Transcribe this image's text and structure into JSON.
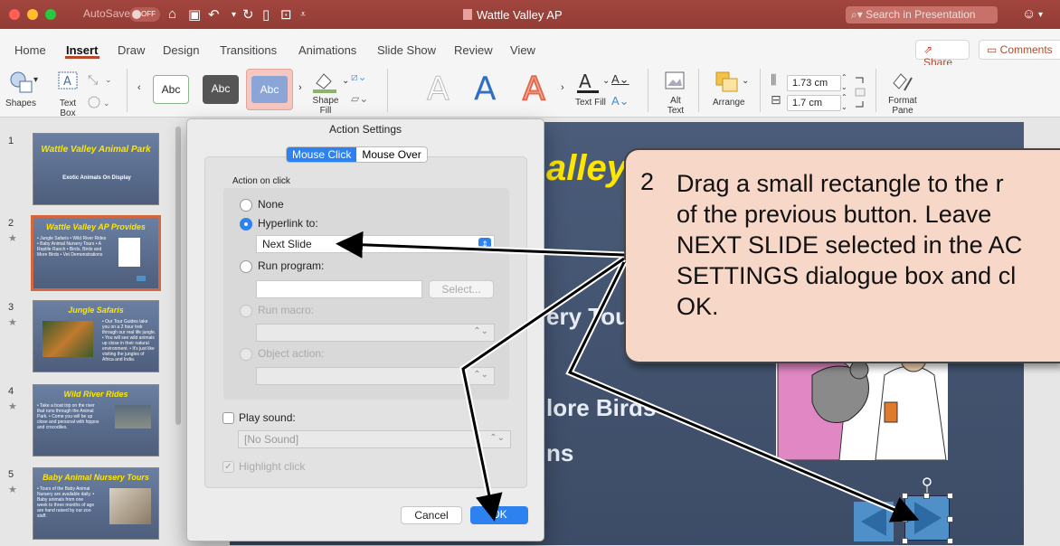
{
  "titlebar": {
    "autosave": "AutoSave",
    "autosave_state": "OFF",
    "title": "Wattle Valley AP",
    "search_placeholder": "Search in Presentation"
  },
  "tabs": [
    "Home",
    "Insert",
    "Draw",
    "Design",
    "Transitions",
    "Animations",
    "Slide Show",
    "Review",
    "View"
  ],
  "share_label": "Share",
  "comments_label": "Comments",
  "ribbon": {
    "shapes": "Shapes",
    "text_box_1": "Text",
    "text_box_2": "Box",
    "style_abc": "Abc",
    "shape_fill_1": "Shape",
    "shape_fill_2": "Fill",
    "text_fill": "Text Fill",
    "alt_text_1": "Alt",
    "alt_text_2": "Text",
    "arrange": "Arrange",
    "height": "1.73 cm",
    "width": "1.7 cm",
    "format_pane_1": "Format",
    "format_pane_2": "Pane"
  },
  "slides": [
    {
      "num": "1",
      "title": "Wattle Valley Animal Park",
      "body": "Exotic Animals On Display"
    },
    {
      "num": "2",
      "title": "Wattle Valley AP Provides",
      "body": "• Jungle Safaris • Wild River Rides • Baby Animal Nursery Tours • A Reptile Ranch • Birds, Birds and More Birds • Vet Demonstrations"
    },
    {
      "num": "3",
      "title": "Jungle Safaris",
      "body": "• Our Tour Guides take you on a 2 hour trek through our real life jungle. • You will see wild animals up close in their natural environment. • It's just like visiting the jungles of Africa and India."
    },
    {
      "num": "4",
      "title": "Wild River Rides",
      "body": "• Take a boat trip on the river that runs through the Animal Park. • Come you will be up close and personal with hippos and crocodiles."
    },
    {
      "num": "5",
      "title": "Baby Animal Nursery Tours",
      "body": "• Tours of the Baby Animal Nursery are available daily. • Baby animals from one week to three months of age are hand raised by our zoo staff."
    }
  ],
  "main_slide": {
    "title_fragment": "alley",
    "bullet_1": "ery Tou",
    "bullet_2": "lore Birds",
    "bullet_3": "ns"
  },
  "dialog": {
    "title": "Action Settings",
    "tab_mouse_click": "Mouse Click",
    "tab_mouse_over": "Mouse Over",
    "action_on_click": "Action on click",
    "none": "None",
    "hyperlink_to": "Hyperlink to:",
    "hyperlink_value": "Next Slide",
    "run_program": "Run program:",
    "select": "Select...",
    "run_macro": "Run macro:",
    "object_action": "Object action:",
    "play_sound": "Play sound:",
    "sound_value": "[No Sound]",
    "highlight_click": "Highlight click",
    "cancel": "Cancel",
    "ok": "OK"
  },
  "callout": {
    "number": "2",
    "lines": [
      "Drag a small rectangle to the r",
      "of the previous button. Leave",
      "NEXT SLIDE selected in the AC",
      "SETTINGS dialogue box and cl",
      "OK."
    ]
  },
  "colors": {
    "accent": "#b7472a",
    "selection": "#2e82f0",
    "slide_title": "#ffe600",
    "callout": "#f7d8c8"
  }
}
